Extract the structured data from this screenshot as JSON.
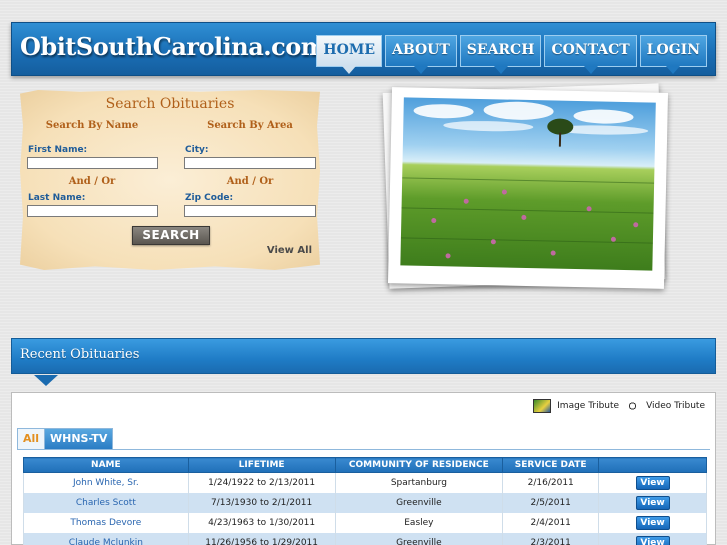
{
  "header": {
    "logo": "ObitSouthCarolina.com",
    "nav": [
      {
        "label": "HOME",
        "active": true
      },
      {
        "label": "ABOUT",
        "active": false
      },
      {
        "label": "SEARCH",
        "active": false
      },
      {
        "label": "CONTACT",
        "active": false
      },
      {
        "label": "LOGIN",
        "active": false
      }
    ]
  },
  "search": {
    "title": "Search Obituaries",
    "by_name": "Search By Name",
    "by_area": "Search By Area",
    "first_name_label": "First Name:",
    "city_label": "City:",
    "and_or_1": "And / Or",
    "and_or_2": "And / Or",
    "last_name_label": "Last Name:",
    "zip_label": "Zip Code:",
    "button": "SEARCH",
    "view_all": "View All"
  },
  "recent": {
    "title": "Recent Obituaries",
    "legend_image": "Image Tribute",
    "legend_video": "Video Tribute",
    "tabs": [
      "All",
      "WHNS-TV"
    ],
    "columns": [
      "NAME",
      "LIFETIME",
      "COMMUNITY OF RESIDENCE",
      "SERVICE DATE",
      ""
    ],
    "rows": [
      {
        "name": "John White, Sr.",
        "lifetime": "1/24/1922 to 2/13/2011",
        "community": "Spartanburg",
        "service_date": "2/16/2011",
        "action": "View"
      },
      {
        "name": "Charles Scott",
        "lifetime": "7/13/1930 to 2/1/2011",
        "community": "Greenville",
        "service_date": "2/5/2011",
        "action": "View"
      },
      {
        "name": "Thomas Devore",
        "lifetime": "4/23/1963 to 1/30/2011",
        "community": "Easley",
        "service_date": "2/4/2011",
        "action": "View"
      },
      {
        "name": "Claude Mclunkin",
        "lifetime": "11/26/1956 to 1/29/2011",
        "community": "Greenville",
        "service_date": "2/3/2011",
        "action": "View"
      }
    ]
  }
}
